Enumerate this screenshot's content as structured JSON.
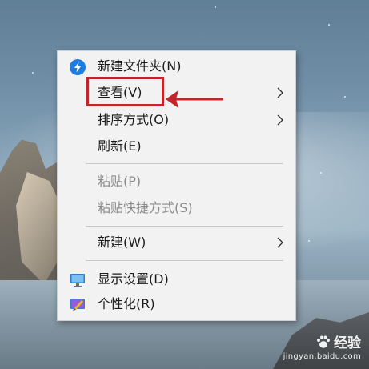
{
  "menu": {
    "items": [
      {
        "label": "新建文件夹(N)",
        "icon": "new-folder-blue-icon",
        "submenu": false,
        "disabled": false
      },
      {
        "label": "查看(V)",
        "submenu": true,
        "disabled": false
      },
      {
        "label": "排序方式(O)",
        "submenu": true,
        "disabled": false
      },
      {
        "label": "刷新(E)",
        "submenu": false,
        "disabled": false
      },
      {
        "label": "粘贴(P)",
        "submenu": false,
        "disabled": true
      },
      {
        "label": "粘贴快捷方式(S)",
        "submenu": false,
        "disabled": true
      },
      {
        "label": "新建(W)",
        "submenu": true,
        "disabled": false
      },
      {
        "label": "显示设置(D)",
        "icon": "display-settings-icon",
        "submenu": false,
        "disabled": false
      },
      {
        "label": "个性化(R)",
        "icon": "personalize-icon",
        "submenu": false,
        "disabled": false
      }
    ]
  },
  "annotation": {
    "color": "#c0262b",
    "target": "查看(V)"
  },
  "watermark": {
    "brand": "经验",
    "url": "jingyan.baidu.com"
  },
  "colors": {
    "menu_bg": "#f2f2f2",
    "disabled_text": "#8a8a8a",
    "accent_blue": "#1e7be0"
  }
}
